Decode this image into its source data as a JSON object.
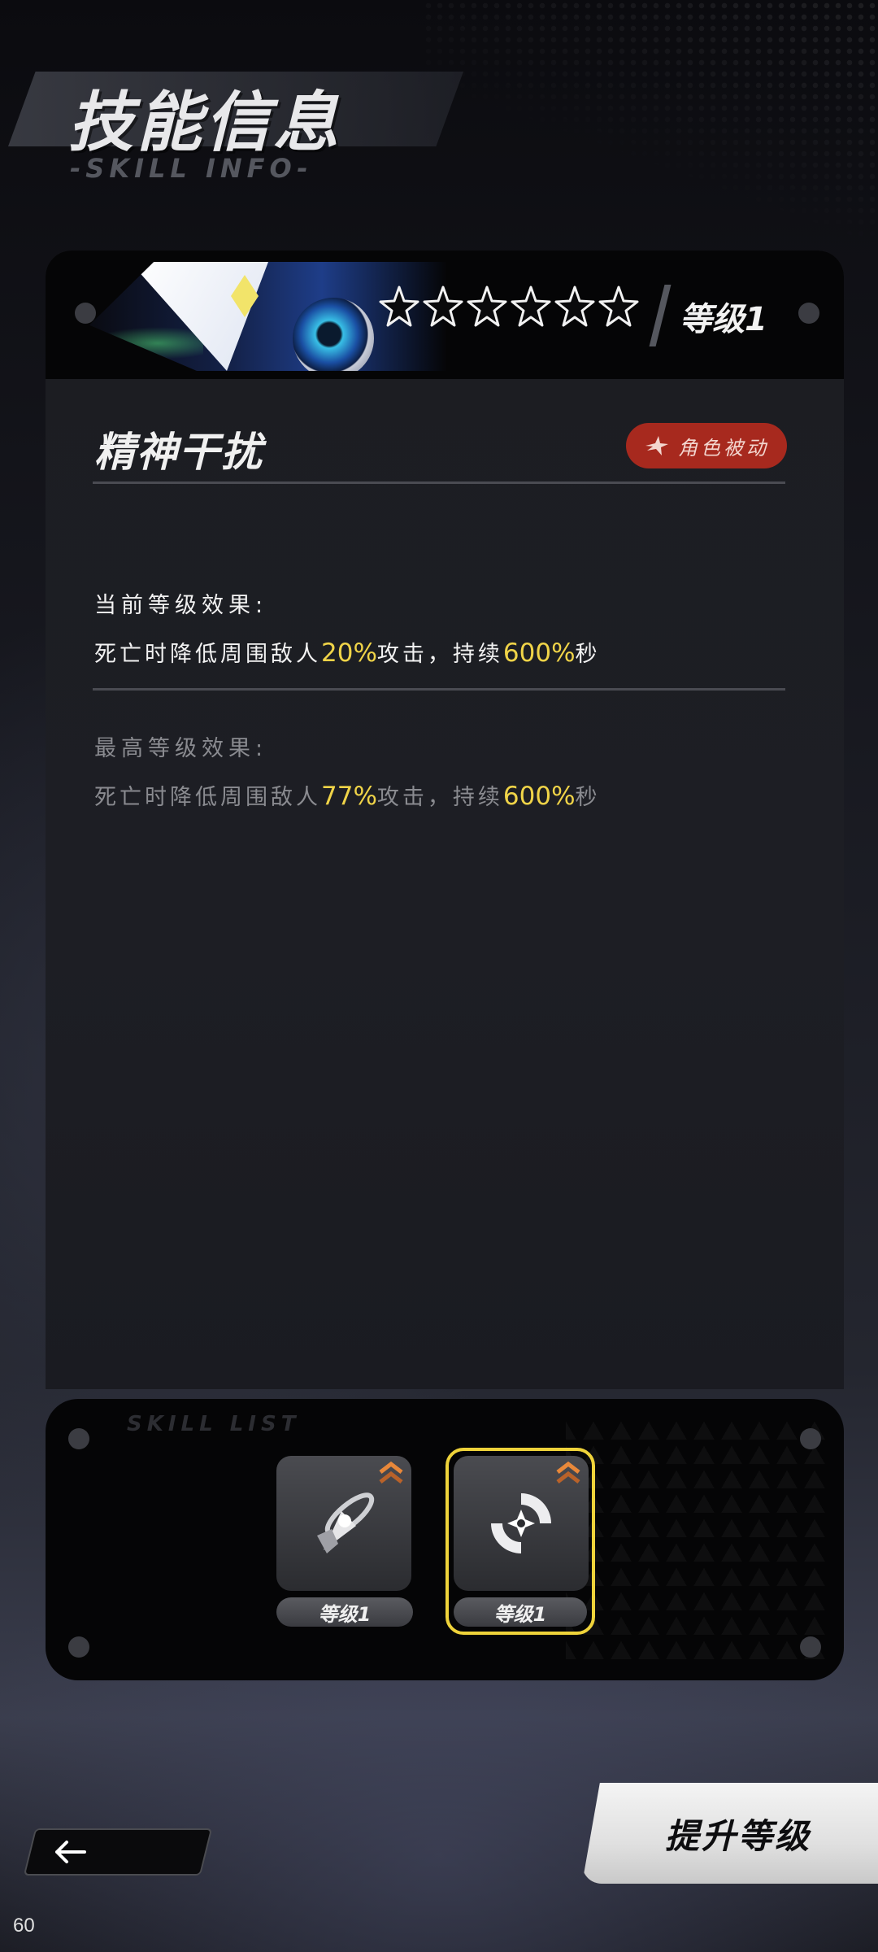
{
  "header": {
    "title": "技能信息",
    "subtitle": "-SKILL INFO-"
  },
  "skill_card": {
    "stars_total": 6,
    "stars_filled": 0,
    "level_label": "等级1",
    "skill_name": "精神干扰",
    "tag_label": "角色被动",
    "current_effect_title": "当前等级效果:",
    "current_effect": {
      "prefix": "死亡时降低周围敌人",
      "value1": "20%",
      "middle": "攻击，持续",
      "value2": "600%",
      "suffix": "秒"
    },
    "max_effect_title": "最高等级效果:",
    "max_effect": {
      "prefix": "死亡时降低周围敌人",
      "value1": "77%",
      "middle": "攻击，持续",
      "value2": "600%",
      "suffix": "秒"
    }
  },
  "skill_list": {
    "title": "SKILL LIST",
    "items": [
      {
        "level_label": "等级1",
        "icon": "rocket-icon",
        "selected": false
      },
      {
        "level_label": "等级1",
        "icon": "crosshair-icon",
        "selected": true
      }
    ]
  },
  "buttons": {
    "upgrade_label": "提升等级",
    "back_icon": "arrow-left-icon"
  },
  "fps": "60",
  "colors": {
    "highlight": "#f0d448",
    "tag_bg": "#a7291e",
    "selected_border": "#efd33a"
  }
}
